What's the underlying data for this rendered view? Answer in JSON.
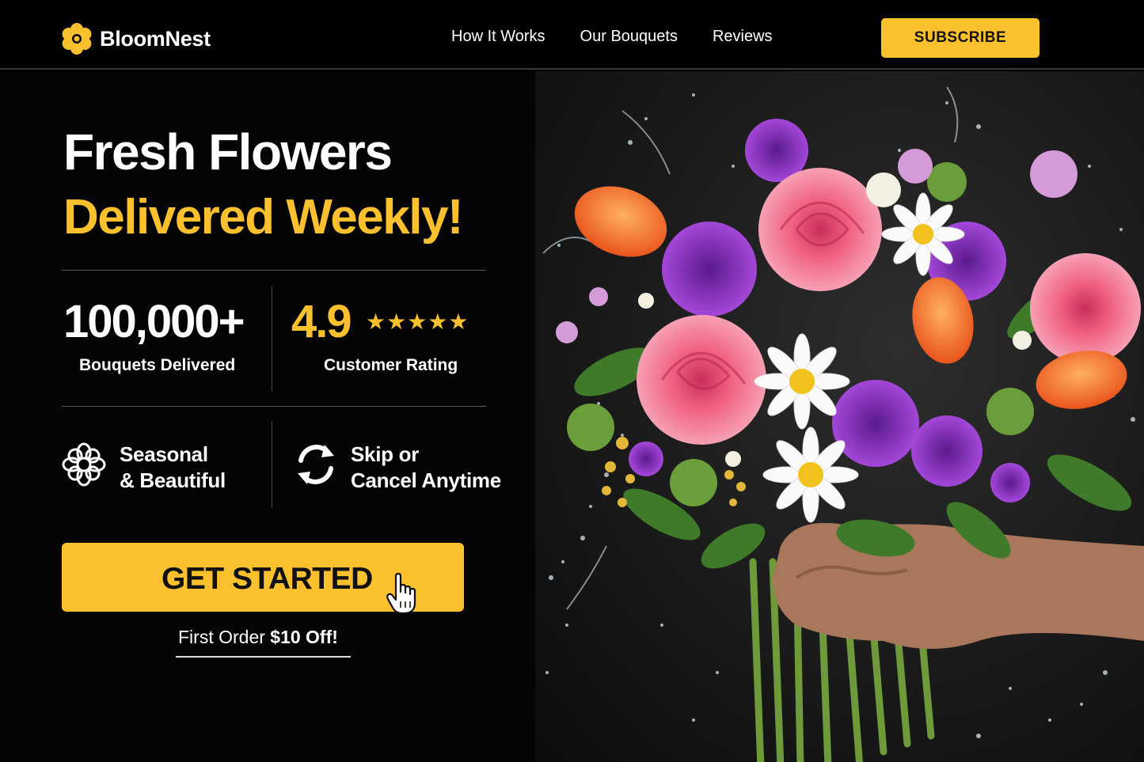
{
  "brand": {
    "name": "BloomNest",
    "accent": "#fbc02d",
    "logo_icon": "flower-logo-icon"
  },
  "nav": {
    "links": [
      "How It Works",
      "Our Bouquets",
      "Reviews"
    ],
    "subscribe_label": "SUBSCRIBE"
  },
  "hero": {
    "headline_line1": "Fresh Flowers",
    "headline_line2": "Delivered Weekly!",
    "stats": [
      {
        "value": "100,000+",
        "label": "Bouquets Delivered"
      },
      {
        "value": "4.9",
        "stars": "★★★★★",
        "rating": 5,
        "label": "Customer Rating"
      }
    ],
    "features": [
      {
        "icon": "flower-icon",
        "line1": "Seasonal",
        "line2": "& Beautiful"
      },
      {
        "icon": "refresh-icon",
        "line1": "Skip or",
        "line2": "Cancel Anytime"
      }
    ],
    "cta_label": "GET STARTED",
    "cursor_icon": "pointer-hand-icon",
    "offer_prefix": "First Order",
    "offer_amount": "$10 Off!"
  },
  "image": {
    "subject": "bouquet-photo"
  }
}
